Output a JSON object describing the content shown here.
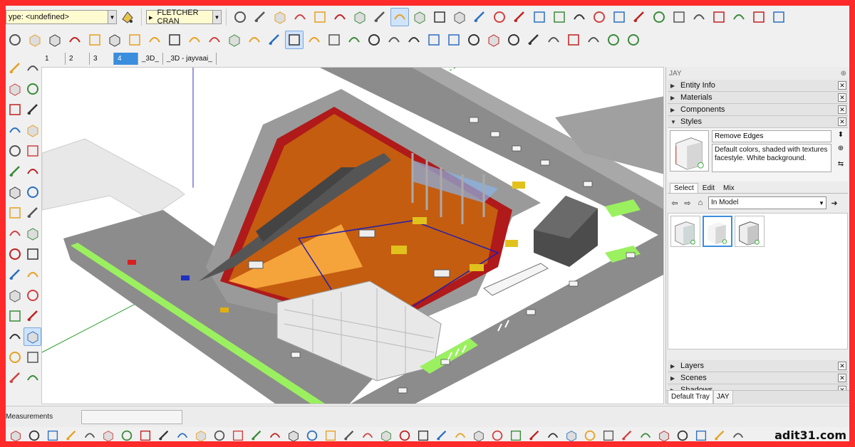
{
  "toolbar_top": {
    "type_combo": "ype: <undefined>",
    "font_combo": "FLETCHER CRAN",
    "icons_row1": [
      "cursor-icon",
      "paint-bucket-icon",
      "box-icon",
      "box-outline-icon",
      "box-open-icon",
      "cube-icon",
      "box-solid-icon",
      "layers-icon",
      "shaded-cube-icon",
      "target-icon",
      "section-icon",
      "orbit-box-icon",
      "pencil-icon",
      "freehand-icon",
      "rectangle-icon",
      "rotated-rectangle-icon",
      "circle-icon",
      "polygon-icon",
      "arc-icon",
      "two-point-arc-icon",
      "pie-icon",
      "three-point-arc-icon",
      "house-icon",
      "house-front-icon",
      "house-outline-icon",
      "barn-icon",
      "house-plain-icon",
      "store-icon"
    ],
    "icons_row2": [
      "eraser-icon",
      "move-icon",
      "pushpull-icon",
      "rotate-icon",
      "followme-icon",
      "scale-icon",
      "offset-icon",
      "tape-measure-icon",
      "dimension-icon",
      "protractor-icon",
      "text-icon",
      "axes-icon",
      "3d-text-icon",
      "orbit-icon",
      "pan-icon",
      "zoom-icon",
      "zoom-window-icon",
      "zoom-extents-icon",
      "previous-view-icon",
      "position-camera-icon",
      "walk-icon",
      "look-around-icon",
      "footprints-icon",
      "cylinder-icon",
      "box-3d-icon",
      "weight-icon",
      "camera-movie-icon",
      "sandbox-icon",
      "film-reel-icon",
      "drape-icon",
      "smoove-icon",
      "stamp-icon"
    ]
  },
  "scene_tabs": [
    "1",
    "2",
    "3",
    "4",
    "_3D_",
    "_3D - jayvaai_"
  ],
  "selected_scene": "4",
  "tray": {
    "title": "JAY",
    "panels_top": [
      "Entity Info",
      "Materials",
      "Components",
      "Styles"
    ],
    "style_name": "Remove Edges",
    "style_description": "Default colors, shaded with textures facestyle. White background.",
    "subtabs": [
      "Select",
      "Edit",
      "Mix"
    ],
    "collection": "In Model",
    "panels_bottom": [
      "Layers",
      "Scenes",
      "Shadows"
    ],
    "tray_tabs": [
      "Default Tray",
      "JAY"
    ]
  },
  "status": {
    "measurements_label": "Measurements"
  },
  "watermark": "adit31.com",
  "colors": {
    "frame": "#ff2a2a",
    "accent": "#3b8ddd",
    "excavation": "#c45d10",
    "wall": "#b01a1a",
    "road": "#8c8c8c",
    "grass": "#9bf060"
  }
}
